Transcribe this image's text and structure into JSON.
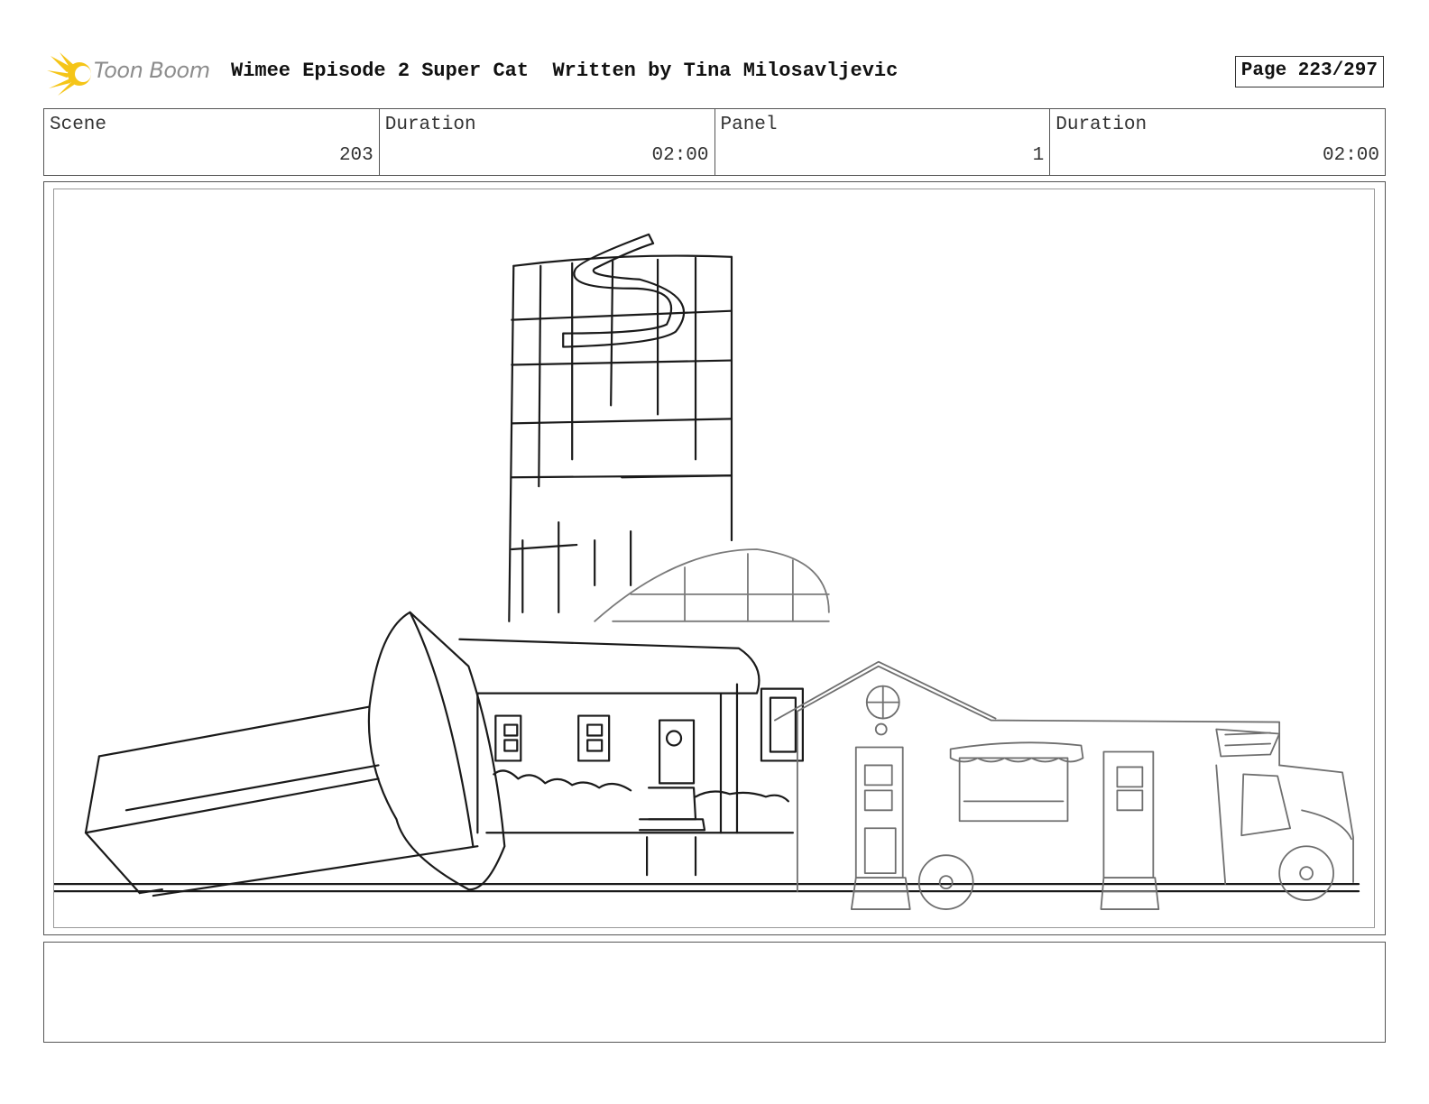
{
  "header": {
    "logo_text": "Toon Boom",
    "title": "Wimee Episode 2 Super Cat  Written by Tina Milosavljevic",
    "page": "Page 223/297"
  },
  "info": {
    "scene_label": "Scene",
    "scene_value": "203",
    "scene_duration_label": "Duration",
    "scene_duration_value": "02:00",
    "panel_label": "Panel",
    "panel_value": "1",
    "panel_duration_label": "Duration",
    "panel_duration_value": "02:00"
  },
  "notes": {
    "text": ""
  },
  "colors": {
    "logo_star": "#f5c518",
    "logo_text": "#8c8c8c",
    "border": "#555555",
    "sketch_dark": "#1a1a1a",
    "sketch_light": "#7a7a7a"
  }
}
